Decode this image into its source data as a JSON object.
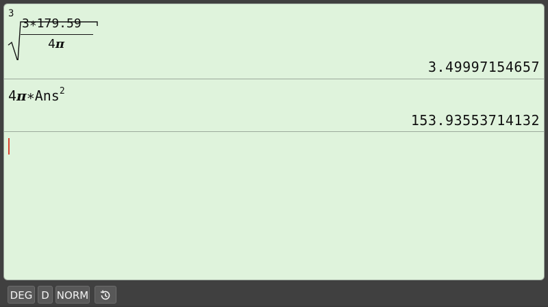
{
  "history": [
    {
      "expression": {
        "root_index": "3",
        "numerator": "3∗179.59",
        "denominator_coef": "4",
        "denominator_symbol": "π"
      },
      "result": "3.49997154657"
    },
    {
      "expression": {
        "coef": "4",
        "symbol": "π",
        "op": "∗Ans",
        "exponent": "2"
      },
      "result": "153.93553714132"
    }
  ],
  "status": {
    "angle_mode": "DEG",
    "display_mode": "D",
    "number_format": "NORM",
    "history_icon": "history-icon"
  },
  "colors": {
    "display_bg": "#dff3dc",
    "cursor": "#d9402b",
    "status_bg": "#404040"
  }
}
